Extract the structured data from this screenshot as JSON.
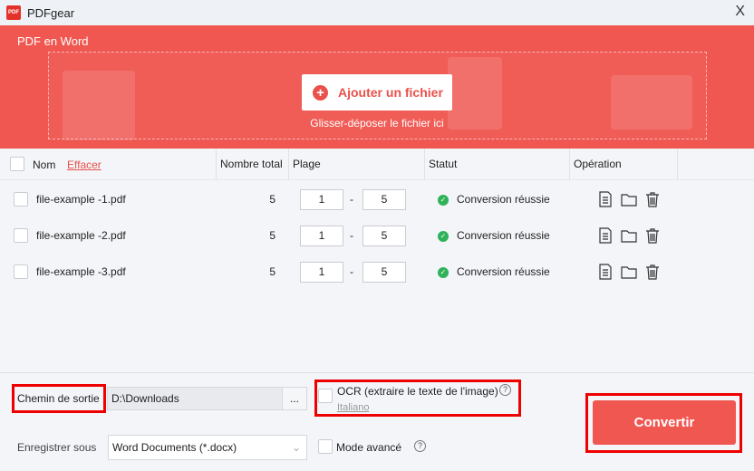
{
  "window": {
    "title": "PDFgear",
    "close": "X"
  },
  "banner": {
    "title": "PDF en Word",
    "add_file": "Ajouter un fichier",
    "drop_hint": "Glisser-déposer le fichier ici"
  },
  "table": {
    "col_name": "Nom",
    "clear": "Effacer",
    "col_total": "Nombre total",
    "col_range": "Plage",
    "col_status": "Statut",
    "col_operation": "Opération",
    "range_sep": "-",
    "rows": [
      {
        "name": "file-example -1.pdf",
        "total": "5",
        "from": "1",
        "to": "5",
        "status": "Conversion réussie"
      },
      {
        "name": "file-example -2.pdf",
        "total": "5",
        "from": "1",
        "to": "5",
        "status": "Conversion réussie"
      },
      {
        "name": "file-example -3.pdf",
        "total": "5",
        "from": "1",
        "to": "5",
        "status": "Conversion réussie"
      }
    ]
  },
  "bottom": {
    "output_label": "Chemin de sortie",
    "output_path": "D:\\Downloads",
    "browse": "...",
    "ocr_label": "OCR (extraire le texte de l'image)",
    "ocr_language": "Italiano",
    "save_as_label": "Enregistrer sous",
    "save_as_value": "Word Documents (*.docx)",
    "advanced_mode": "Mode avancé",
    "help": "?",
    "convert": "Convertir"
  },
  "colors": {
    "accent": "#f05751",
    "success": "#2fb25a",
    "highlight": "#ee0000"
  }
}
